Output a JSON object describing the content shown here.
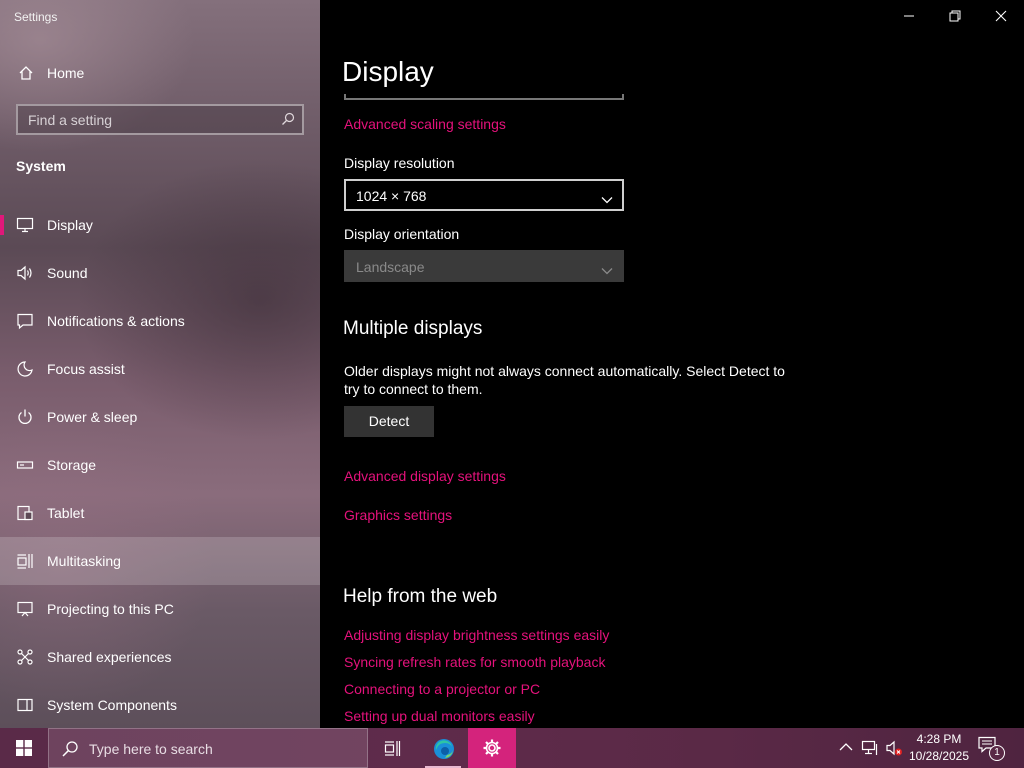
{
  "window": {
    "title": "Settings",
    "controls": {
      "minimize": "minimize-icon",
      "restore": "restore-icon",
      "close": "close-icon"
    }
  },
  "sidebar": {
    "home_label": "Home",
    "search_placeholder": "Find a setting",
    "section_title": "System",
    "items": [
      {
        "label": "Display",
        "icon": "monitor-icon",
        "selected": true
      },
      {
        "label": "Sound",
        "icon": "speaker-icon"
      },
      {
        "label": "Notifications & actions",
        "icon": "notification-icon"
      },
      {
        "label": "Focus assist",
        "icon": "moon-icon"
      },
      {
        "label": "Power & sleep",
        "icon": "power-icon"
      },
      {
        "label": "Storage",
        "icon": "storage-icon"
      },
      {
        "label": "Tablet",
        "icon": "tablet-icon"
      },
      {
        "label": "Multitasking",
        "icon": "multitasking-icon",
        "hovered": true
      },
      {
        "label": "Projecting to this PC",
        "icon": "projecting-icon"
      },
      {
        "label": "Shared experiences",
        "icon": "shared-icon"
      },
      {
        "label": "System Components",
        "icon": "components-icon"
      }
    ]
  },
  "main": {
    "page_title": "Display",
    "advanced_scaling_link": "Advanced scaling settings",
    "resolution": {
      "label": "Display resolution",
      "value": "1024 × 768"
    },
    "orientation": {
      "label": "Display orientation",
      "value": "Landscape",
      "disabled": true
    },
    "multiple_displays": {
      "heading": "Multiple displays",
      "description": "Older displays might not always connect automatically. Select Detect to try to connect to them.",
      "detect_button": "Detect",
      "advanced_display_link": "Advanced display settings",
      "graphics_link": "Graphics settings"
    },
    "help": {
      "heading": "Help from the web",
      "links": [
        "Adjusting display brightness settings easily",
        "Syncing refresh rates for smooth playback",
        "Connecting to a projector or PC",
        "Setting up dual monitors easily"
      ]
    }
  },
  "taskbar": {
    "search_text": "Type here to search",
    "time": "4:28 PM",
    "date": "10/28/2025",
    "notification_count": "1"
  },
  "colors": {
    "accent": "#e5127c",
    "selection_marker": "#e0187a",
    "active_taskbar": "#d4237c"
  }
}
